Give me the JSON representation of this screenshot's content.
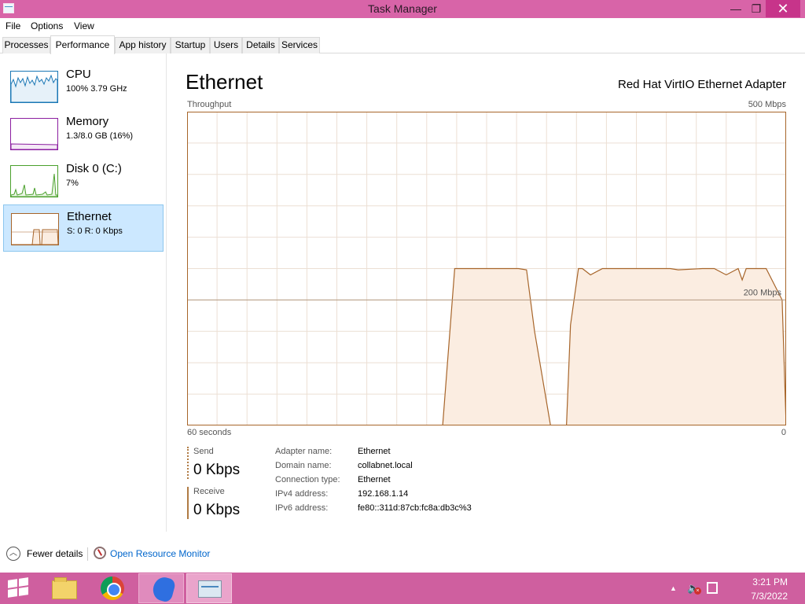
{
  "window": {
    "title": "Task Manager",
    "minimize_glyph": "—",
    "restore_glyph": "❐",
    "close_glyph": "✕"
  },
  "menu": [
    "File",
    "Options",
    "View"
  ],
  "tabs": [
    {
      "label": "Processes"
    },
    {
      "label": "Performance",
      "active": true
    },
    {
      "label": "App history"
    },
    {
      "label": "Startup"
    },
    {
      "label": "Users"
    },
    {
      "label": "Details"
    },
    {
      "label": "Services"
    }
  ],
  "sidebar": {
    "items": [
      {
        "name": "CPU",
        "sub": "100% 3.79 GHz",
        "color": "#1a77b5"
      },
      {
        "name": "Memory",
        "sub": "1.3/8.0 GB (16%)",
        "color": "#8b1ea0"
      },
      {
        "name": "Disk 0 (C:)",
        "sub": "7%",
        "color": "#4aa02c"
      },
      {
        "name": "Ethernet",
        "sub": "S: 0 R: 0 Kbps",
        "color": "#a7652a",
        "selected": true
      }
    ]
  },
  "main": {
    "title": "Ethernet",
    "adapter": "Red Hat VirtIO Ethernet Adapter",
    "throughput_label": "Throughput",
    "max_label": "500 Mbps",
    "mid_label": "200 Mbps",
    "time_left_label": "60 seconds",
    "time_right_label": "0"
  },
  "chart_data": {
    "type": "area",
    "title": "Throughput",
    "ylabel": "",
    "xlabel": "60 seconds",
    "xlim": [
      60,
      0
    ],
    "ylim": [
      0,
      500
    ],
    "ref_line": 200,
    "grid": true,
    "color": "#a7652a",
    "fill": "#fbede1",
    "series": [
      {
        "x": [
          60,
          40,
          34.4,
          33.2,
          28.4,
          27.6,
          26.8,
          26.0,
          25.2,
          23.6,
          23.2,
          22.0,
          21.6,
          20.8,
          20.4,
          19.6,
          18.4,
          16.4,
          13.2,
          11.6,
          10.8,
          8.4,
          7.2,
          6.0,
          4.8,
          4.4,
          4.0,
          3.6,
          2.8,
          2.0,
          0.4,
          0
        ],
        "y": [
          0,
          0,
          0,
          250,
          250,
          250,
          250,
          248,
          150,
          0,
          0,
          0,
          160,
          250,
          250,
          240,
          250,
          250,
          250,
          250,
          248,
          250,
          250,
          240,
          250,
          232,
          250,
          250,
          250,
          250,
          200,
          0
        ]
      },
      {
        "x": [
          60,
          0
        ],
        "y": [
          200,
          200
        ]
      }
    ]
  },
  "stats": {
    "send_label": "Send",
    "send_value": "0 Kbps",
    "receive_label": "Receive",
    "receive_value": "0 Kbps"
  },
  "details": [
    {
      "key": "Adapter name:",
      "value": "Ethernet"
    },
    {
      "key": "Domain name:",
      "value": "collabnet.local"
    },
    {
      "key": "Connection type:",
      "value": "Ethernet"
    },
    {
      "key": "IPv4 address:",
      "value": "192.168.1.14"
    },
    {
      "key": "IPv6 address:",
      "value": "fe80::311d:87cb:fc8a:db3c%3"
    }
  ],
  "footer": {
    "fewer_details": "Fewer details",
    "open_resource_monitor": "Open Resource Monitor"
  },
  "taskbar": {
    "apps": [
      "file-explorer-icon",
      "chrome-icon",
      "app-icon",
      "task-manager-icon"
    ],
    "time": "3:21 PM",
    "date": "7/3/2022"
  }
}
